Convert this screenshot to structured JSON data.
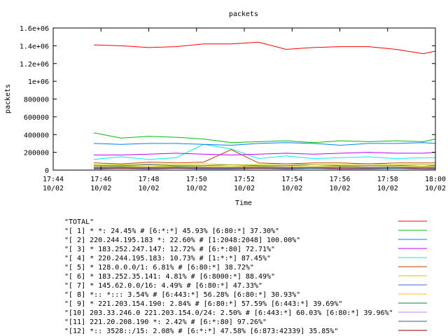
{
  "chart_data": {
    "type": "line",
    "title": "packets",
    "xlabel": "Time",
    "ylabel": "packets",
    "ylim": [
      0,
      1600000
    ],
    "yticks": [
      {
        "value": 0,
        "label": "0"
      },
      {
        "value": 200000,
        "label": "200000"
      },
      {
        "value": 400000,
        "label": "400000"
      },
      {
        "value": 600000,
        "label": "600000"
      },
      {
        "value": 800000,
        "label": "800000"
      },
      {
        "value": 1000000,
        "label": "1e+06"
      },
      {
        "value": 1200000,
        "label": "1.2e+06"
      },
      {
        "value": 1400000,
        "label": "1.4e+06"
      },
      {
        "value": 1600000,
        "label": "1.6e+06"
      }
    ],
    "xrange_minutes": [
      0,
      16
    ],
    "xticks": [
      {
        "minutes": 0,
        "time": "17:44",
        "date": "10/02"
      },
      {
        "minutes": 2,
        "time": "17:46",
        "date": "10/02"
      },
      {
        "minutes": 4,
        "time": "17:48",
        "date": "10/02"
      },
      {
        "minutes": 6,
        "time": "17:50",
        "date": "10/02"
      },
      {
        "minutes": 8,
        "time": "17:52",
        "date": "10/02"
      },
      {
        "minutes": 10,
        "time": "17:54",
        "date": "10/02"
      },
      {
        "minutes": 12,
        "time": "17:56",
        "date": "10/02"
      },
      {
        "minutes": 14,
        "time": "17:58",
        "date": "10/02"
      },
      {
        "minutes": 16,
        "time": "18:00",
        "date": "10/02"
      }
    ],
    "x_minutes": [
      1.7,
      2.85,
      4.0,
      5.15,
      6.3,
      7.45,
      8.6,
      9.75,
      10.9,
      12.05,
      13.2,
      14.35,
      15.5,
      16.0
    ],
    "series": [
      {
        "name": "\"TOTAL\"",
        "color": "#ff0000",
        "values": [
          1410000,
          1400000,
          1380000,
          1390000,
          1420000,
          1420000,
          1440000,
          1360000,
          1380000,
          1390000,
          1390000,
          1360000,
          1310000,
          1340000
        ]
      },
      {
        "name": "\"[ 1] * *: 24.45% # [6:*:*] 45.93% [6:80:*] 37.30%\"",
        "color": "#00c000",
        "values": [
          420000,
          360000,
          380000,
          370000,
          350000,
          310000,
          320000,
          330000,
          310000,
          330000,
          320000,
          330000,
          320000,
          350000
        ]
      },
      {
        "name": "\"[ 2] 220.244.195.183 *: 22.60% # [1:2048:2048] 100.00%\"",
        "color": "#0080ff",
        "values": [
          300000,
          290000,
          300000,
          300000,
          290000,
          280000,
          300000,
          310000,
          300000,
          280000,
          300000,
          300000,
          310000,
          300000
        ]
      },
      {
        "name": "\"[ 3] * 183.252.247.147: 12.72% # [6:*:80] 72.71%\"",
        "color": "#c000ff",
        "values": [
          170000,
          170000,
          180000,
          190000,
          180000,
          170000,
          180000,
          190000,
          180000,
          190000,
          200000,
          190000,
          190000,
          200000
        ]
      },
      {
        "name": "\"[ 4] * 220.244.195.183: 10.73% # [1:*:*] 87.45%\"",
        "color": "#00eeee",
        "values": [
          120000,
          150000,
          120000,
          140000,
          290000,
          240000,
          130000,
          160000,
          130000,
          140000,
          150000,
          130000,
          140000,
          140000
        ]
      },
      {
        "name": "\"[ 5] * 128.0.0.0/1: 6.81% # [6:80:*] 38.72%\"",
        "color": "#c04000",
        "values": [
          80000,
          70000,
          90000,
          80000,
          90000,
          230000,
          80000,
          70000,
          80000,
          80000,
          70000,
          80000,
          80000,
          80000
        ]
      },
      {
        "name": "\"[ 6] * 183.252.35.141: 4.81% # [6:8000:*] 88.49%\"",
        "color": "#c8c800",
        "values": [
          60000,
          60000,
          70000,
          60000,
          70000,
          60000,
          60000,
          70000,
          60000,
          60000,
          70000,
          60000,
          60000,
          60000
        ]
      },
      {
        "name": "\"[ 7] * 145.62.0.0/16: 4.49% # [6:80:*] 47.33%\"",
        "color": "#4169e1",
        "values": [
          50000,
          50000,
          60000,
          50000,
          50000,
          60000,
          50000,
          50000,
          60000,
          50000,
          50000,
          50000,
          60000,
          50000
        ]
      },
      {
        "name": "\"[ 8] *:: *::: 3.54% # [6:443:*] 56.28% [6:80:*] 30.93%\"",
        "color": "#ffc020",
        "values": [
          40000,
          45000,
          40000,
          45000,
          40000,
          45000,
          40000,
          45000,
          40000,
          40000,
          45000,
          40000,
          40000,
          45000
        ]
      },
      {
        "name": "\"[ 9] * 221.203.154.190: 2.84% # [6:80:*] 57.59% [6:443:*] 39.69%\"",
        "color": "#008040",
        "values": [
          30000,
          35000,
          30000,
          35000,
          30000,
          30000,
          35000,
          30000,
          30000,
          35000,
          30000,
          30000,
          35000,
          30000
        ]
      },
      {
        "name": "\"[10] 203.33.246.0 221.203.154.0/24: 2.50% # [6:443:*] 60.03% [6:80:*] 39.96%\"",
        "color": "#c080ff",
        "values": [
          25000,
          30000,
          25000,
          30000,
          25000,
          25000,
          30000,
          25000,
          30000,
          25000,
          25000,
          30000,
          25000,
          25000
        ]
      },
      {
        "name": "\"[11] 221.20.208.190 *: 2.42% # [6:*:80] 97.26%\"",
        "color": "#306080",
        "values": [
          20000,
          25000,
          20000,
          25000,
          20000,
          20000,
          25000,
          20000,
          20000,
          25000,
          20000,
          20000,
          25000,
          20000
        ]
      },
      {
        "name": "\"[12] *:: 3528::/15: 2.08% # [6:*:*] 47.58% [6:873:42339] 35.85%\"",
        "color": "#8b0000",
        "values": [
          15000,
          20000,
          15000,
          20000,
          15000,
          15000,
          20000,
          15000,
          20000,
          15000,
          15000,
          20000,
          15000,
          15000
        ]
      }
    ]
  }
}
